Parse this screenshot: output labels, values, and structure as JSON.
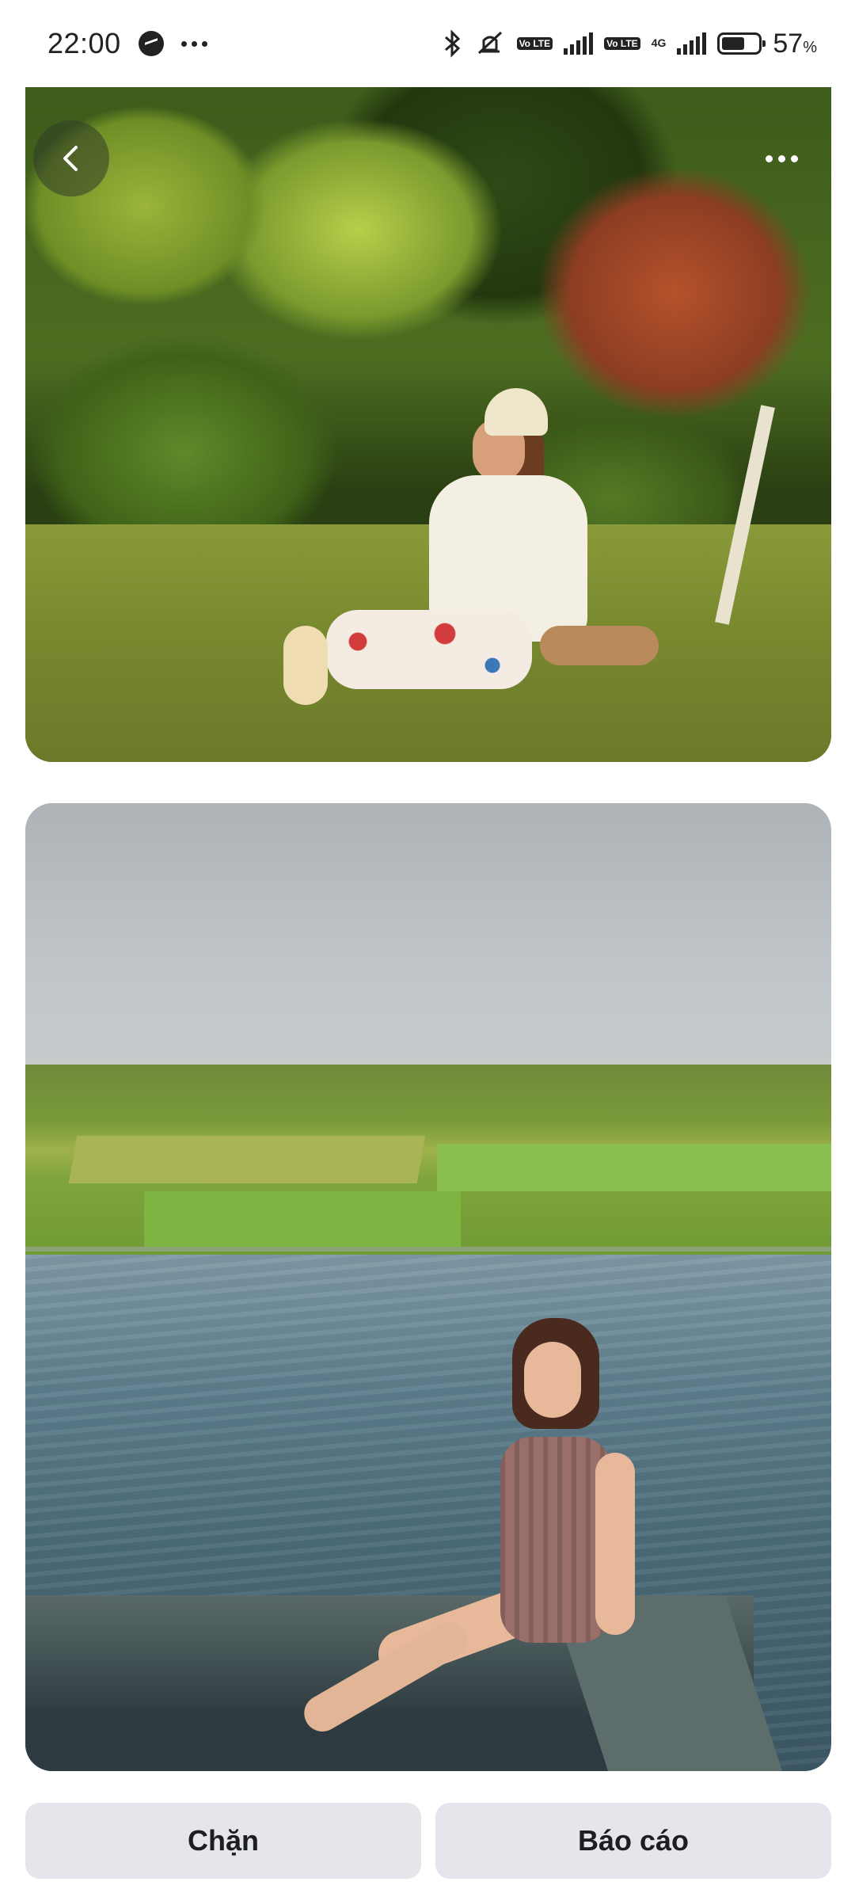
{
  "status_bar": {
    "time": "22:00",
    "battery_percent": "57",
    "battery_unit": "%",
    "network": "4G",
    "volte_label": "Vo LTE",
    "icons": [
      "messenger-icon",
      "more-dots-icon",
      "bluetooth-icon",
      "mute-icon",
      "volte-icon",
      "signal-icon",
      "battery-icon"
    ]
  },
  "photos": [
    {
      "alt_icon": "photo-person-sitting-on-grass"
    },
    {
      "alt_icon": "photo-person-in-infinity-pool"
    }
  ],
  "actions": {
    "block_label": "Chặn",
    "report_label": "Báo cáo"
  },
  "colors": {
    "button_bg": "#e4e6eb",
    "button_text": "#1c1e21"
  }
}
